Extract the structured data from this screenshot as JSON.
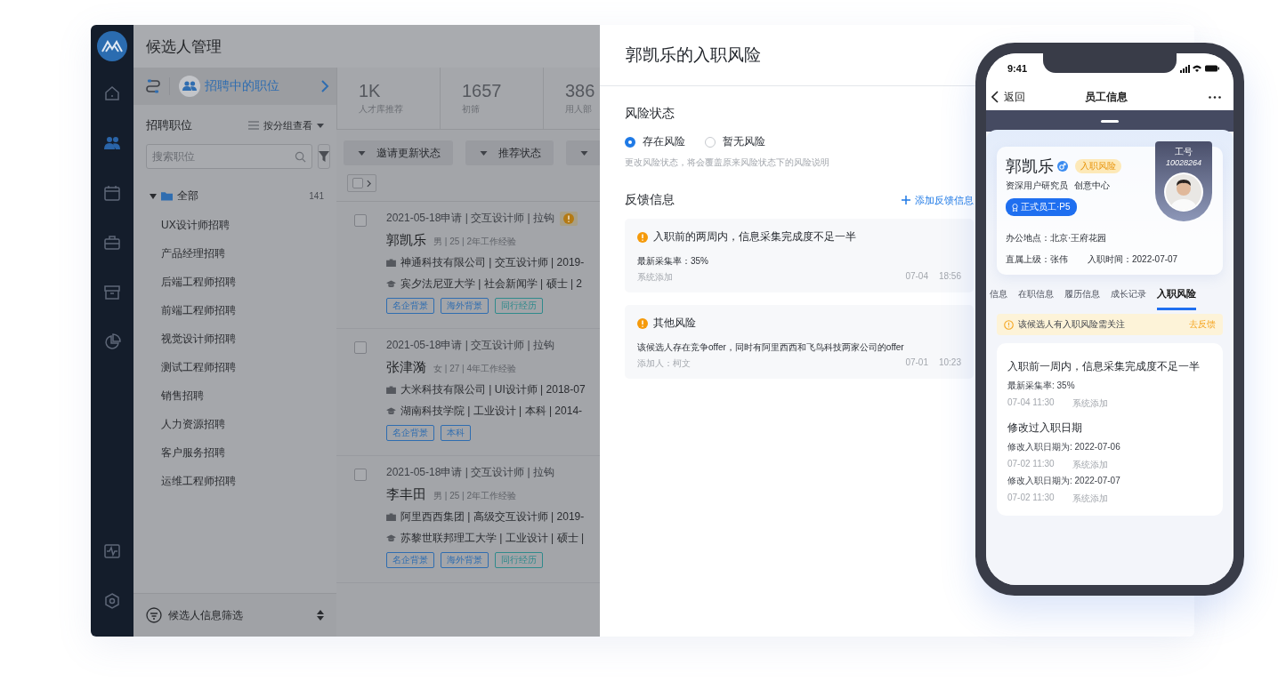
{
  "app": {
    "title": "候选人管理"
  },
  "nav_items": [
    {
      "selected": false
    },
    {
      "selected": true
    },
    {
      "selected": false
    },
    {
      "selected": false
    },
    {
      "selected": false
    },
    {
      "selected": false
    }
  ],
  "nav_bottom": [
    {
      "selected": false
    },
    {
      "selected": false
    }
  ],
  "position_header": {
    "label": "招聘中的职位"
  },
  "positions": {
    "title": "招聘职位",
    "view": "按分组查看",
    "search_placeholder": "搜索职位",
    "tree": {
      "label": "全部",
      "count": "141",
      "expanded": true,
      "children": [
        {
          "label": "UX设计师招聘"
        },
        {
          "label": "产品经理招聘"
        },
        {
          "label": "后端工程师招聘"
        },
        {
          "label": "前端工程师招聘"
        },
        {
          "label": "视觉设计师招聘"
        },
        {
          "label": "测试工程师招聘"
        },
        {
          "label": "销售招聘"
        },
        {
          "label": "人力资源招聘"
        },
        {
          "label": "客户服务招聘"
        },
        {
          "label": "运维工程师招聘"
        }
      ]
    }
  },
  "filter_footer": {
    "label": "候选人信息筛选"
  },
  "stats": [
    {
      "value": "1K",
      "label": "人才库推荐"
    },
    {
      "value": "1657",
      "label": "初筛"
    },
    {
      "value": "386",
      "label": "用人部"
    }
  ],
  "filters": [
    {
      "kind": "filter",
      "label": "邀请更新状态"
    },
    {
      "kind": "filter",
      "label": "推荐状态"
    },
    {
      "kind": "cut"
    }
  ],
  "select_all": {
    "checked": false
  },
  "candidates": [
    {
      "checked": false,
      "risk": true,
      "meta": "2021-05-18申请 | 交互设计师 | 拉钩",
      "name": "郭凯乐",
      "info": "男 | 25 | 2年工作经验",
      "work": "神通科技有限公司 | 交互设计师 | 2019-",
      "education": "宾夕法尼亚大学 | 社会新闻学 | 硕士 | 2",
      "tags": [
        {
          "label": "名企背景",
          "color": "#2f6db0"
        },
        {
          "label": "海外背景",
          "color": "#2f6db0"
        },
        {
          "label": "同行经历",
          "color": "#2f8a8c"
        }
      ]
    },
    {
      "checked": false,
      "risk": false,
      "meta": "2021-05-18申请 | 交互设计师 | 拉钩",
      "name": "张津漪",
      "info": "女 | 27 | 4年工作经验",
      "work": "大米科技有限公司 | UI设计师 | 2018-07",
      "education": "湖南科技学院 | 工业设计 | 本科 | 2014-",
      "tags": [
        {
          "label": "名企背景",
          "color": "#2f6db0"
        },
        {
          "label": "本科",
          "color": "#2f6db0"
        }
      ]
    },
    {
      "checked": false,
      "risk": false,
      "meta": "2021-05-18申请 | 交互设计师 | 拉钩",
      "name": "李丰田",
      "info": "男 | 25 | 2年工作经验",
      "work": "阿里西西集团 | 高级交互设计师 | 2019-",
      "education": "苏黎世联邦理工大学 | 工业设计 | 硕士 |",
      "tags": [
        {
          "label": "名企背景",
          "color": "#2f6db0"
        },
        {
          "label": "海外背景",
          "color": "#2f6db0"
        },
        {
          "label": "同行经历",
          "color": "#2f8a8c"
        }
      ]
    }
  ],
  "drawer": {
    "title": "郭凯乐的入职风险",
    "risk_title": "风险状态",
    "options": [
      {
        "label": "存在风险",
        "selected": true
      },
      {
        "label": "暂无风险",
        "selected": false
      }
    ],
    "hint": "更改风险状态，将会覆盖原来风险状态下的风险说明",
    "feedback_title": "反馈信息",
    "add_label": "添加反馈信息",
    "feedback": [
      {
        "title": "入职前的两周内，信息采集完成度不足一半",
        "body": "最新采集率：35%",
        "author": "系统添加",
        "date": "07-04",
        "time": "18:56"
      },
      {
        "title": "其他风险",
        "body": "该候选人存在竞争offer，同时有阿里西西和飞鸟科技两家公司的offer",
        "author": "添加人：柯文",
        "date": "07-01",
        "time": "10:23"
      }
    ]
  },
  "phone": {
    "time": "9:41",
    "back": "返回",
    "title": "员工信息",
    "employee": {
      "name": "郭凯乐",
      "badge": "入职风险",
      "role": "资深用户研究员",
      "department": "创意中心",
      "grade": "正式员工·P5",
      "id_label": "工号",
      "id": "10028264",
      "office": "办公地点：北京·王府花园",
      "manager": "直属上级：张伟",
      "hire_date": "入职时间：2022-07-07"
    },
    "tabs": [
      {
        "label": "信息",
        "selected": false
      },
      {
        "label": "在职信息",
        "selected": false
      },
      {
        "label": "履历信息",
        "selected": false
      },
      {
        "label": "成长记录",
        "selected": false
      },
      {
        "label": "入职风险",
        "selected": true
      }
    ],
    "alert": {
      "text": "该候选人有入职风险需关注",
      "action": "去反馈"
    },
    "records": [
      {
        "title": "入职前一周内，信息采集完成度不足一半",
        "entries": [
          {
            "text": "最新采集率: 35%",
            "time": "07-04 11:30",
            "source": "系统添加"
          }
        ]
      },
      {
        "title": "修改过入职日期",
        "entries": [
          {
            "text": "修改入职日期为: 2022-07-06",
            "time": "07-02 11:30",
            "source": "系统添加"
          },
          {
            "text": "修改入职日期为: 2022-07-07",
            "time": "07-02 11:30",
            "source": "系统添加"
          }
        ]
      }
    ]
  }
}
